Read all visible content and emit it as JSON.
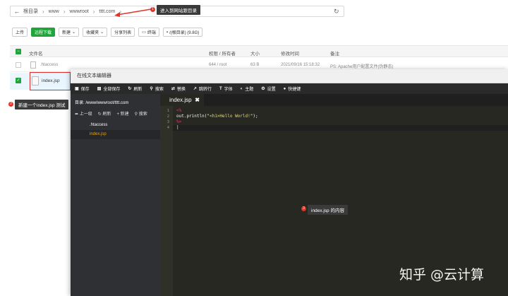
{
  "path_bar": {
    "crumbs": [
      "根目录",
      "www",
      "wwwroot",
      "tttt.com"
    ],
    "back_icon": "arrow-left-icon",
    "refresh_icon": "refresh-icon"
  },
  "callouts": {
    "enter_dir": {
      "number": "1",
      "text": "进入到网站跟目录"
    },
    "new_file": {
      "number": "2",
      "text": "新建一个index.jsp 测试"
    },
    "file_content": {
      "number": "3",
      "text": "index.jsp 的内容"
    }
  },
  "toolbar": {
    "upload": "上传",
    "remote_download": "远程下载",
    "new": "新建",
    "favorites": "收藏夹",
    "share_list": "分享列表",
    "terminal": "终端",
    "disk": "/(根目录) (9.8G)"
  },
  "file_table": {
    "headers": {
      "name": "文件名",
      "perm": "权限 / 所有者",
      "size": "大小",
      "mtime": "修改时间",
      "note": "备注"
    },
    "rows": [
      {
        "name": ".htaccess",
        "perm": "644 / root",
        "size": "63 B",
        "mtime": "2021/09/16 15:18:32",
        "note": "PS: Apache用户配置文件(伪静态)"
      },
      {
        "name": "index.jsp"
      }
    ]
  },
  "editor": {
    "title": "在线文本编辑器",
    "tools": [
      "保存",
      "全部保存",
      "刷新",
      "搜索",
      "替换",
      "跳转行",
      "字体",
      "主题",
      "设置",
      "快捷键"
    ],
    "sidebar": {
      "dir": "目录: /www/wwwroot/tttt.com",
      "actions": [
        "上一级",
        "刷新",
        "新建",
        "搜索"
      ],
      "files": [
        ".htaccess",
        "index.jsp"
      ]
    },
    "tab": {
      "name": "index.jsp",
      "close": "✖"
    },
    "line_numbers": [
      "1",
      "2",
      "3",
      "4"
    ],
    "code": {
      "l1": "<%",
      "l2_prefix": "out.println(\"",
      "l2_str": "<h1>Hello World!",
      "l2_suffix": "\");",
      "l3": "%>",
      "l4": "|"
    },
    "collapse": "‹"
  },
  "watermark": "知乎 @云计算",
  "colors": {
    "green": "#20a53a",
    "red": "#e0352b",
    "editor_bg": "#272822"
  }
}
